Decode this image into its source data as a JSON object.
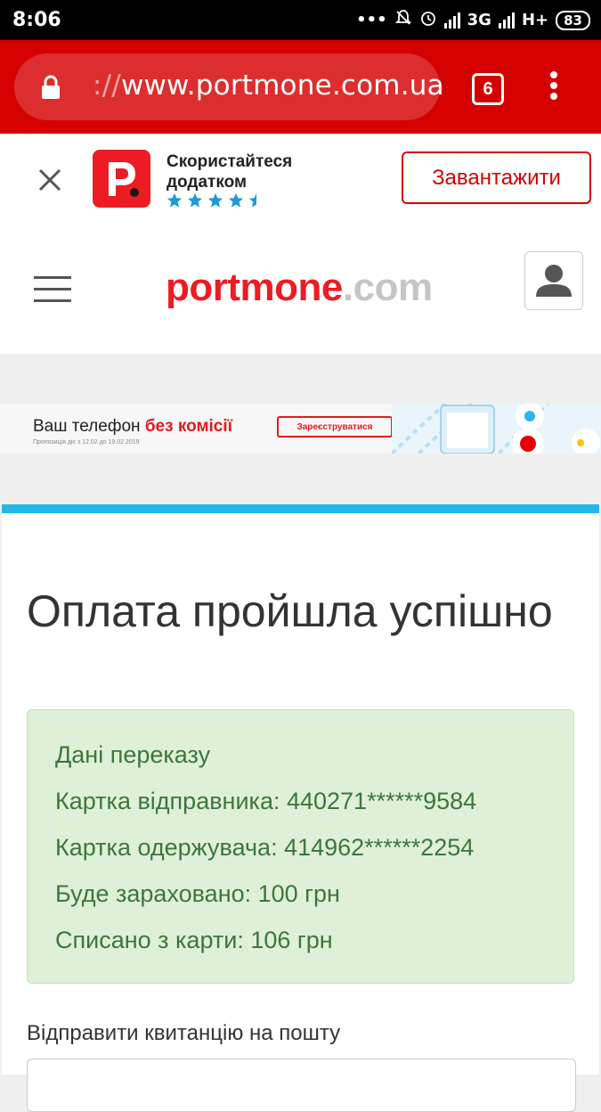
{
  "status_bar": {
    "time": "8:06",
    "network_1": "3G",
    "network_2": "H+",
    "battery": "83"
  },
  "browser": {
    "url_prefix": "://",
    "url_main": "www.portmone.com.ua",
    "tab_count": "6"
  },
  "app_banner": {
    "title_line1": "Скористайтеся",
    "title_line2": "додатком",
    "rating": 4.5,
    "download_label": "Завантажити"
  },
  "header": {
    "logo_main": "portmone",
    "logo_suffix": ".com"
  },
  "promo": {
    "headline": "Ваш телефон",
    "headline_accent": "без комісії",
    "note": "Пропозиція діє з 12.02 до 19.02.2019",
    "cta": "Зареєструватися"
  },
  "payment": {
    "title": "Оплата пройшла успішно",
    "details_heading": "Дані переказу",
    "sender_card": "Картка відправника: 440271******9584",
    "recipient_card": "Картка одержувача: 414962******2254",
    "credited": "Буде зараховано: 100 грн",
    "debited": "Списано з карти: 106 грн",
    "send_receipt_label": "Відправити квитанцію на пошту",
    "email_value": ""
  },
  "colors": {
    "brand_red": "#d50000",
    "accent_blue": "#22b8e8",
    "success_bg": "#dff0d8",
    "success_text": "#3c763d"
  }
}
